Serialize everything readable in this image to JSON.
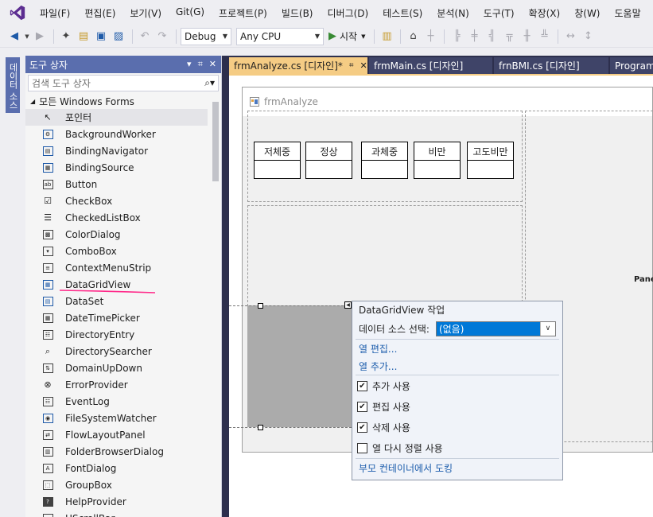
{
  "menu": [
    "파일(F)",
    "편집(E)",
    "보기(V)",
    "Git(G)",
    "프로젝트(P)",
    "빌드(B)",
    "디버그(D)",
    "테스트(S)",
    "분석(N)",
    "도구(T)",
    "확장(X)",
    "창(W)",
    "도움말"
  ],
  "toolbar": {
    "config": "Debug",
    "platform": "Any CPU",
    "start_label": "시작"
  },
  "left_strip": {
    "tab_label": "데이터 소스"
  },
  "toolbox": {
    "title": "도구 상자",
    "search_placeholder": "검색 도구 상자",
    "group": "모든 Windows Forms",
    "items": [
      {
        "label": "포인터",
        "icon": "pointer-icon"
      },
      {
        "label": "BackgroundWorker",
        "icon": "background-worker-icon"
      },
      {
        "label": "BindingNavigator",
        "icon": "binding-navigator-icon"
      },
      {
        "label": "BindingSource",
        "icon": "binding-source-icon"
      },
      {
        "label": "Button",
        "icon": "button-icon"
      },
      {
        "label": "CheckBox",
        "icon": "checkbox-icon"
      },
      {
        "label": "CheckedListBox",
        "icon": "checked-listbox-icon"
      },
      {
        "label": "ColorDialog",
        "icon": "color-dialog-icon"
      },
      {
        "label": "ComboBox",
        "icon": "combobox-icon"
      },
      {
        "label": "ContextMenuStrip",
        "icon": "context-menu-icon"
      },
      {
        "label": "DataGridView",
        "icon": "datagridview-icon"
      },
      {
        "label": "DataSet",
        "icon": "dataset-icon"
      },
      {
        "label": "DateTimePicker",
        "icon": "datetime-picker-icon"
      },
      {
        "label": "DirectoryEntry",
        "icon": "directory-entry-icon"
      },
      {
        "label": "DirectorySearcher",
        "icon": "directory-searcher-icon"
      },
      {
        "label": "DomainUpDown",
        "icon": "domain-updown-icon"
      },
      {
        "label": "ErrorProvider",
        "icon": "error-provider-icon"
      },
      {
        "label": "EventLog",
        "icon": "eventlog-icon"
      },
      {
        "label": "FileSystemWatcher",
        "icon": "filesystem-watcher-icon"
      },
      {
        "label": "FlowLayoutPanel",
        "icon": "flowlayout-panel-icon"
      },
      {
        "label": "FolderBrowserDialog",
        "icon": "folder-browser-icon"
      },
      {
        "label": "FontDialog",
        "icon": "font-dialog-icon"
      },
      {
        "label": "GroupBox",
        "icon": "groupbox-icon"
      },
      {
        "label": "HelpProvider",
        "icon": "help-provider-icon"
      },
      {
        "label": "HScrollBar",
        "icon": "hscrollbar-icon"
      }
    ]
  },
  "doc_tabs": [
    {
      "label": "frmAnalyze.cs [디자인]*",
      "active": true
    },
    {
      "label": "frmMain.cs [디자인]",
      "active": false
    },
    {
      "label": "frnBMI.cs [디자인]",
      "active": false
    },
    {
      "label": "Program.",
      "active": false
    }
  ],
  "form": {
    "title": "frmAnalyze",
    "categories": [
      "저체중",
      "정상",
      "과체중",
      "비만",
      "고도비만"
    ],
    "right_panel_label": "Pane"
  },
  "popup": {
    "title": "DataGridView 작업",
    "datasource_label": "데이터 소스 선택:",
    "datasource_value": "(없음)",
    "links": [
      "열 편집...",
      "열 추가..."
    ],
    "options": [
      {
        "label": "추가 사용",
        "checked": true
      },
      {
        "label": "편집 사용",
        "checked": true
      },
      {
        "label": "삭제 사용",
        "checked": true
      },
      {
        "label": "열 다시 정렬 사용",
        "checked": false
      }
    ],
    "dock_link": "부모 컨테이너에서 도킹"
  },
  "colors": {
    "accent": "#5a6eae",
    "active_tab": "#f5cc84",
    "doc_bg": "#2d2f4d",
    "link": "#1c5dac",
    "select_blue": "#0078d7",
    "annotation_red": "#ff2a8a"
  }
}
